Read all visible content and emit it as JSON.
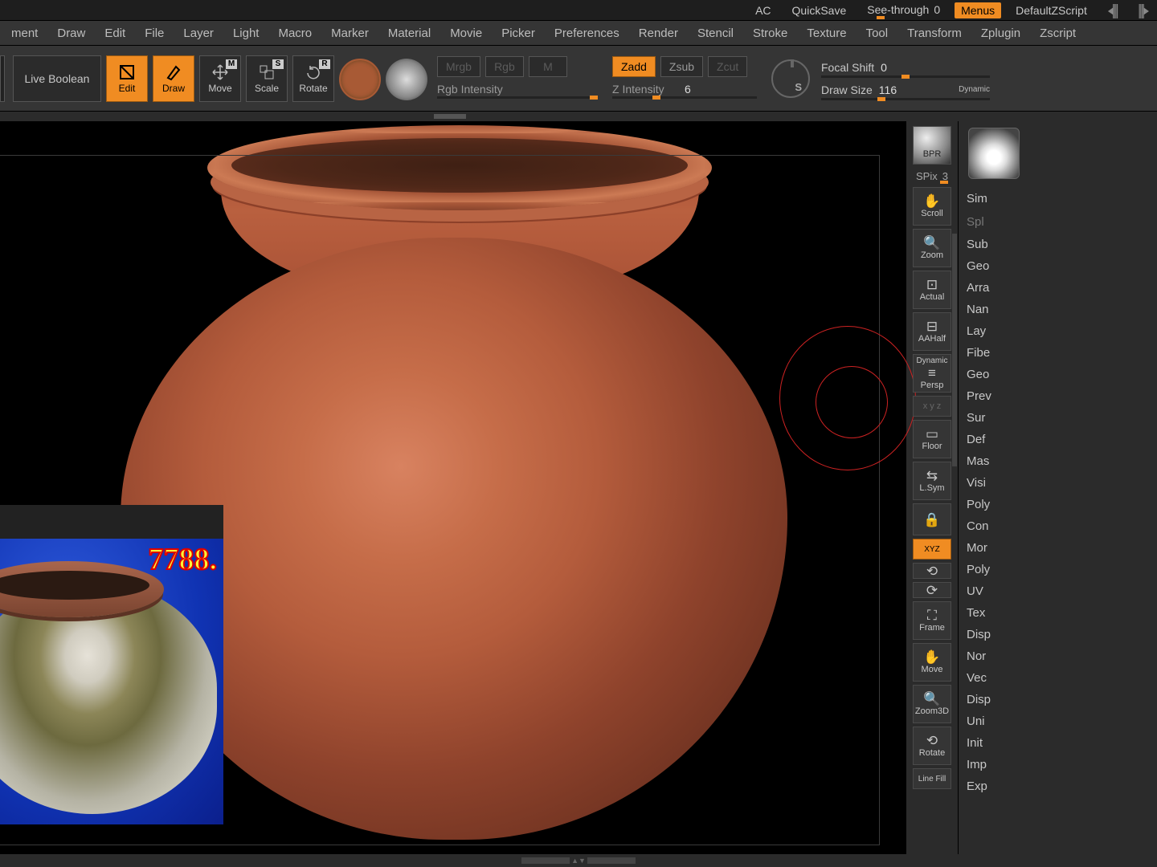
{
  "topbar": {
    "ac": "AC",
    "quicksave": "QuickSave",
    "see_through_label": "See-through",
    "see_through_value": "0",
    "menus": "Menus",
    "default_zscript": "DefaultZScript"
  },
  "menubar": [
    "ment",
    "Draw",
    "Edit",
    "File",
    "Layer",
    "Light",
    "Macro",
    "Marker",
    "Material",
    "Movie",
    "Picker",
    "Preferences",
    "Render",
    "Stencil",
    "Stroke",
    "Texture",
    "Tool",
    "Transform",
    "Zplugin",
    "Zscript"
  ],
  "tools": {
    "live_boolean": "Live Boolean",
    "edit": "Edit",
    "draw": "Draw",
    "move": "Move",
    "scale": "Scale",
    "rotate": "Rotate"
  },
  "color_modes": {
    "mrgb": "Mrgb",
    "rgb": "Rgb",
    "m": "M"
  },
  "z_modes": {
    "zadd": "Zadd",
    "zsub": "Zsub",
    "zcut": "Zcut"
  },
  "sliders": {
    "rgb_intensity_label": "Rgb Intensity",
    "z_intensity_label": "Z Intensity",
    "z_intensity_value": "6",
    "focal_shift_label": "Focal Shift",
    "focal_shift_value": "0",
    "draw_size_label": "Draw Size",
    "draw_size_value": "116",
    "dynamic": "Dynamic"
  },
  "right_buttons": {
    "bpr": "BPR",
    "spix_label": "SPix",
    "spix_value": "3",
    "scroll": "Scroll",
    "zoom": "Zoom",
    "actual": "Actual",
    "aahalf": "AAHalf",
    "dynamic": "Dynamic",
    "persp": "Persp",
    "floor": "Floor",
    "lsym": "L.Sym",
    "xyz": "XYZ",
    "frame": "Frame",
    "move": "Move",
    "zoom3d": "Zoom3D",
    "rotate": "Rotate",
    "linefill": "Line Fill"
  },
  "far_panel": {
    "head1": "Sim",
    "head2": "Spl",
    "items": [
      "Sub",
      "Geo",
      "Arra",
      "Nan",
      "Lay",
      "Fibe",
      "Geo",
      "Prev",
      "Sur",
      "Def",
      "Mas",
      "Visi",
      "Poly",
      "Con",
      "Mor",
      "Poly",
      "UV",
      "Tex",
      "Disp",
      "Nor",
      "Vec",
      "Disp",
      "Uni",
      "Init",
      "Imp",
      "Exp"
    ]
  },
  "reference": {
    "watermark": "7788."
  }
}
